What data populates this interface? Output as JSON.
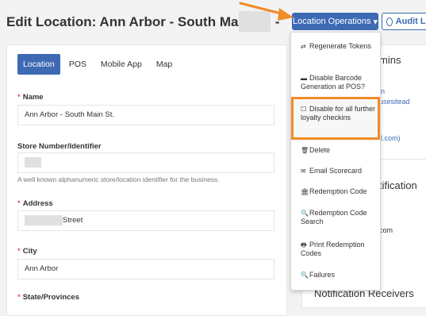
{
  "header": {
    "title": "Edit Location: Ann Arbor - South Main St. -",
    "location_ops_label": "Location Operations",
    "audit_label": "Audit Log"
  },
  "tabs": [
    "Location",
    "POS",
    "Mobile App",
    "Map"
  ],
  "form": {
    "name_label": "Name",
    "name_value": "Ann Arbor - South Main St.",
    "store_label": "Store Number/Identifier",
    "store_help": "A well known alphanumeric store/location identifier for the business.",
    "address_label": "Address",
    "address_value": "Street",
    "city_label": "City",
    "city_value": "Ann Arbor",
    "state_label": "State/Provinces"
  },
  "dropdown": {
    "items": [
      {
        "icon": "refresh-icon",
        "glyph": "⇄",
        "label": "Regenerate Tokens"
      },
      {
        "icon": "minus-icon",
        "glyph": "▬",
        "label": "Disable Barcode Generation at POS?"
      },
      {
        "icon": "checkbox-icon",
        "glyph": "☐",
        "label": "Disable for all further loyalty checkins"
      },
      {
        "icon": "trash-icon",
        "glyph": "🗑",
        "label": "Delete"
      },
      {
        "icon": "envelope-icon",
        "glyph": "✉",
        "label": "Email Scorecard"
      },
      {
        "icon": "bank-icon",
        "glyph": "🏛",
        "label": "Redemption Code"
      },
      {
        "icon": "search-icon",
        "glyph": "🔍",
        "label": "Redemption Code Search"
      },
      {
        "icon": "print-icon",
        "glyph": "🖶",
        "label": "Print Redemption Codes"
      },
      {
        "icon": "search-icon",
        "glyph": "🔍",
        "label": "Failures"
      }
    ]
  },
  "right_panel": {
    "admins_fragment": "mins",
    "link_fragment_1": "in",
    "link_fragment_2": "usesitead",
    "link_fragment_3": "il.com)",
    "notification_fragment": "tification",
    "com_fragment": "com",
    "receivers_label": "Notification Receivers"
  },
  "colors": {
    "primary": "#3d6ab3",
    "highlight": "#f18b26",
    "required": "#ed5565"
  }
}
